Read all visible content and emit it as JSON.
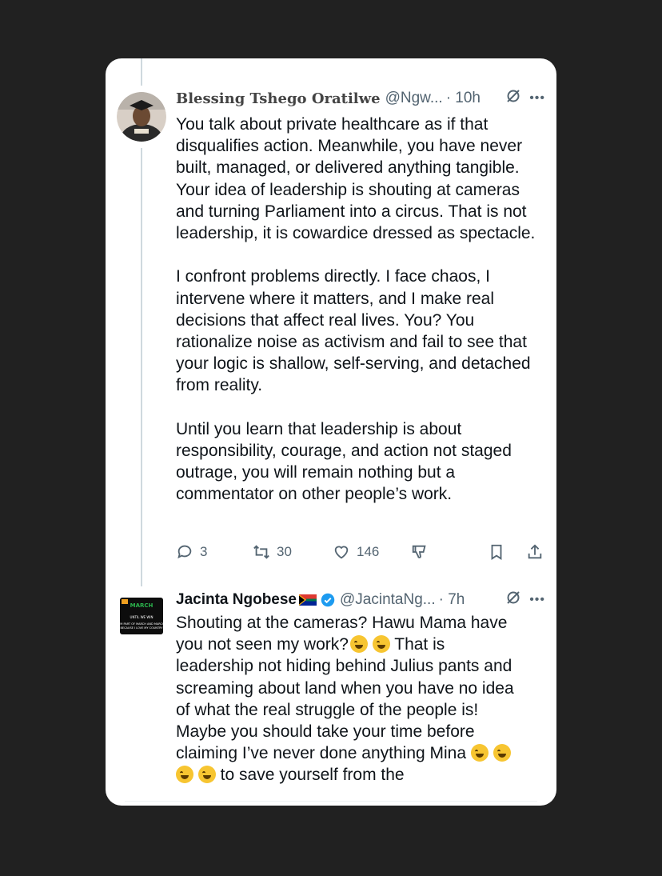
{
  "tweet1": {
    "name": "Blessing Tshego Oratilwe",
    "handle": "@Ngw...",
    "time": "· 10h",
    "body": "You talk about private healthcare as if that disqualifies action. Meanwhile, you have never built, managed, or delivered anything tangible. Your idea of leadership is shouting at cameras and turning Parliament into a circus. That is not leadership, it is cowardice dressed as spectacle.\n\nI confront problems directly. I face chaos, I intervene where it matters, and I make real decisions that affect real lives. You? You rationalize noise as activism and fail to see that your logic is shallow, self-serving, and detached from reality.\n\nUntil you learn that leadership is about responsibility, courage, and action not staged outrage, you will remain nothing but a commentator on other people’s work.",
    "replies": "3",
    "reposts": "30",
    "likes": "146"
  },
  "tweet2": {
    "name": "Jacinta Ngobese",
    "handle": "@JacintaNg...",
    "time": "· 7h",
    "body_lines": [
      "Shouting at the cameras? Hawu Mama have",
      "you not seen my work?",
      " That is",
      "leadership not hiding behind Julius pants and",
      "screaming about land when you have no idea",
      "of what the real struggle of the people is!",
      "Maybe you should take your time before",
      "claiming I’ve never done anything Mina",
      " to save yourself from the"
    ]
  },
  "icons": {
    "reply": "reply-icon",
    "repost": "repost-icon",
    "like": "heart-icon",
    "dislike": "dislike-icon",
    "bookmark": "bookmark-icon",
    "share": "share-icon",
    "grok": "grok-icon",
    "more": "more-icon"
  },
  "colors": {
    "background": "#212121",
    "card": "#ffffff",
    "verified": "#1d9bf0",
    "muted": "#536471"
  }
}
